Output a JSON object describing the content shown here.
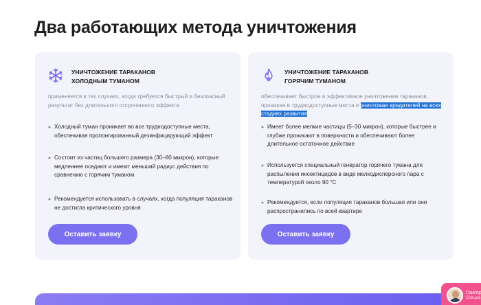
{
  "page": {
    "title": "Два работающих метода уничтожения"
  },
  "cards": [
    {
      "icon": "snowflake-icon",
      "title_line1": "УНИЧТОЖЕНИЕ ТАРАКАНОВ",
      "title_line2": "ХОЛОДНЫМ ТУМАНОМ",
      "description": "применяется в тех случаях, когда требуется быстрый и безопасный результат без длительного отсроченного эффекта",
      "bullets": [
        "Холодный туман проникает во все труднодоступные места, обеспечивая пролонгированный дезинфицирующий эффект",
        "Состоит из частиц большего размера (30–80 микрон), которые медленнее оседают и имеют меньший радиус действия по сравнению с горячим туманом",
        "Рекомендуется использовать в случаях, когда популяция тараканов не достигла критического уровня"
      ],
      "button_label": "Оставить заявку"
    },
    {
      "icon": "flame-icon",
      "title_line1": "УНИЧТОЖЕНИЕ ТАРАКАНОВ",
      "title_line2": "ГОРЯЧИМ ТУМАНОМ",
      "description_plain": "обеспечивает быстрое и эффективное уничтожение тараканов, проникая в труднодоступные места и ",
      "description_highlight": "уничтожая вредителей на всех стадиях развития",
      "bullets": [
        "Имеет более мелкие частицы (5–30 микрон), которые быстрее и глубже проникают в поверхности и обеспечивают более длительное остаточное действие",
        "Используется специальный генератор горячего тумана для распыления инсектицидов в виде мелкодисперсного пара с температурой около 90 °C",
        "Рекомендуется, если популяция тараканов большая или они распространились по всей квартире"
      ],
      "button_label": "Оставить заявку"
    }
  ],
  "chat": {
    "name": "Григор",
    "role": "Специа"
  },
  "colors": {
    "accent": "#7b70f0",
    "card_bg": "#f3f3fb",
    "highlight": "#1f6fd6",
    "chat_bg": "#f2538f"
  }
}
